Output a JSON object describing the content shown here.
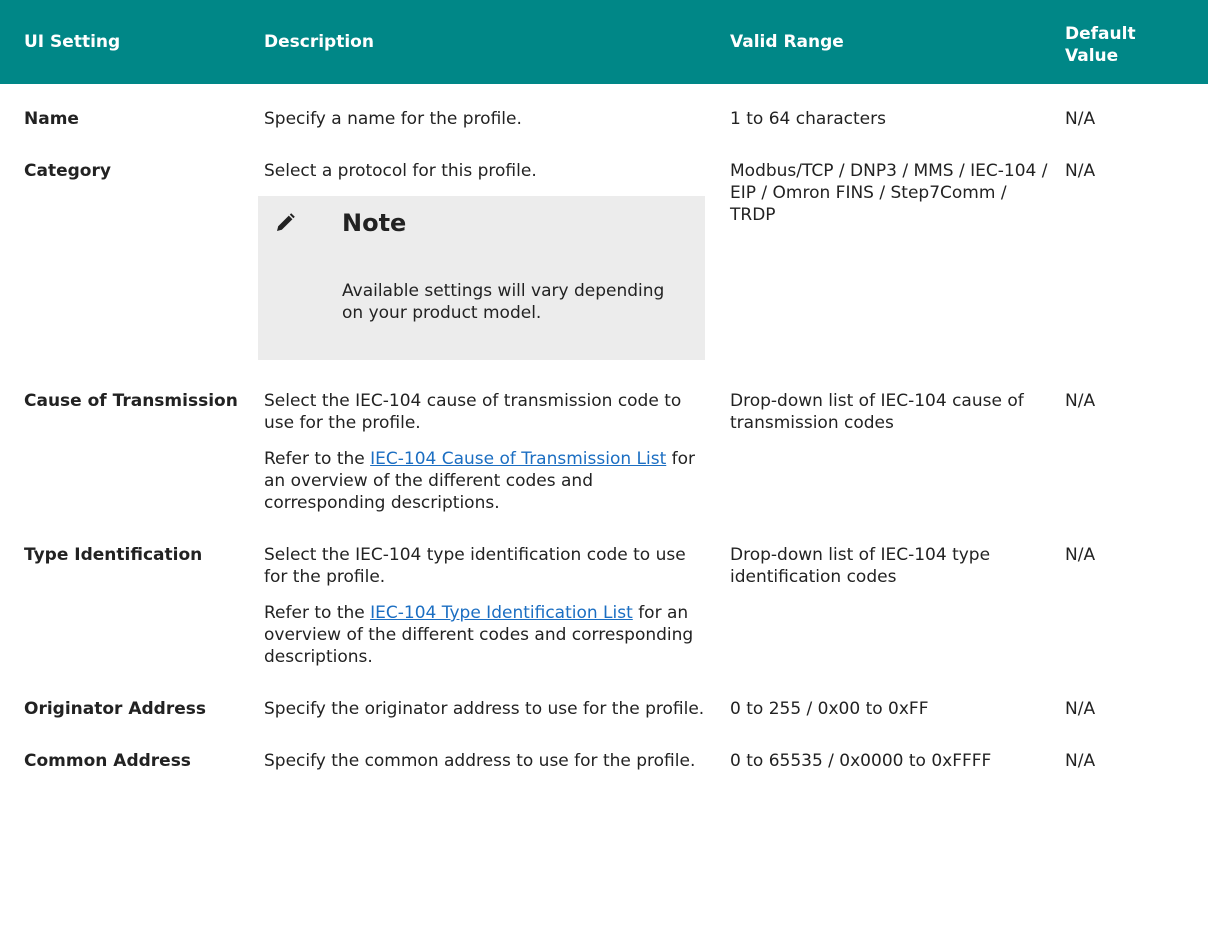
{
  "headers": {
    "setting": "UI Setting",
    "description": "Description",
    "range": "Valid Range",
    "default_line1": "Default",
    "default_line2": "Value"
  },
  "rows": [
    {
      "setting": "Name",
      "description": "Specify a name for the profile.",
      "range": "1 to 64 characters",
      "default": "N/A"
    },
    {
      "setting": "Category",
      "description": "Select a protocol for this profile.",
      "note_title": "Note",
      "note_text": "Available settings will vary depending on your product model.",
      "note_icon": "pencil-icon",
      "range": "Modbus/TCP / DNP3 / MMS / IEC-104 / EIP / Omron FINS / Step7Comm / TRDP",
      "default": "N/A"
    },
    {
      "setting": "Cause of Transmission",
      "description": "Select the IEC-104 cause of transmission code to use for the profile.",
      "ref_prefix": "Refer to the",
      "ref_link": "IEC-104 Cause of Transmission List",
      "ref_suffix": "for an overview of the different codes and corresponding descriptions.",
      "range": "Drop-down list of IEC-104 cause of transmission codes",
      "default": "N/A"
    },
    {
      "setting": "Type Identification",
      "description": "Select the IEC-104 type identification code to use for the profile.",
      "ref_prefix": "Refer to the",
      "ref_link": "IEC-104 Type Identification List",
      "ref_suffix": "for an overview of the different codes and corresponding descriptions.",
      "range": "Drop-down list of IEC-104 type identification codes",
      "default": "N/A"
    },
    {
      "setting": "Originator Address",
      "description": "Specify the originator address to use for the profile.",
      "range": "0 to 255 / 0x00 to 0xFF",
      "default": "N/A"
    },
    {
      "setting": "Common Address",
      "description": "Specify the common address to use for the profile.",
      "range": "0 to 65535 / 0x0000 to 0xFFFF",
      "default": "N/A"
    }
  ],
  "colors": {
    "header_bg": "#008787",
    "header_text": "#ffffff",
    "note_bg": "#ececec",
    "link": "#1b6ec2"
  }
}
